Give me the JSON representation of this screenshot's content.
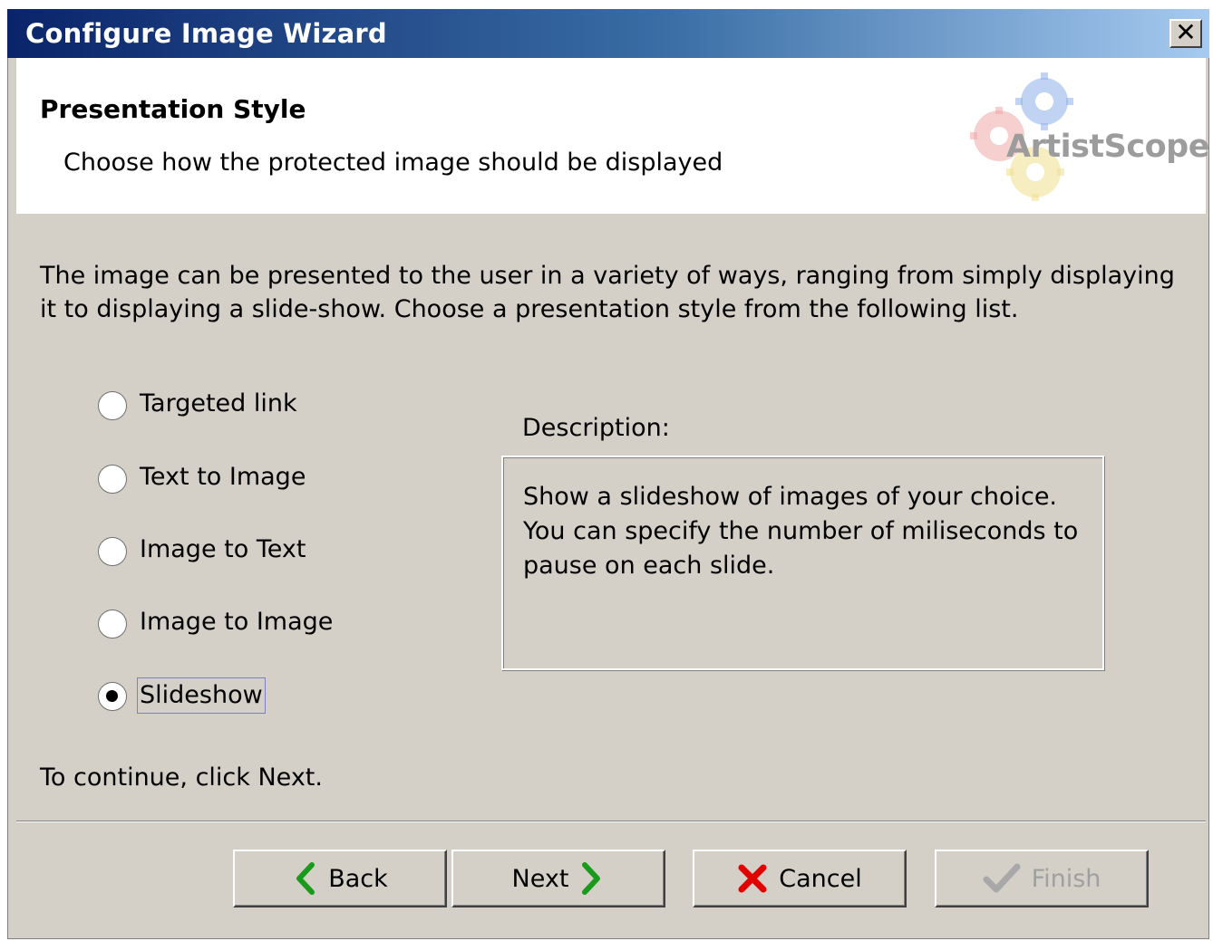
{
  "window": {
    "title": "Configure Image Wizard",
    "close_glyph": "✕"
  },
  "header": {
    "title": "Presentation Style",
    "subtitle": "Choose how the protected image should be displayed",
    "logo_text": "ArtistScope"
  },
  "intro": "The image can be presented to the user in a variety of ways, ranging from simply displaying it to displaying a slide-show. Choose a presentation style from the following list.",
  "options": [
    {
      "label": "Targeted link",
      "checked": false
    },
    {
      "label": "Text to Image",
      "checked": false
    },
    {
      "label": "Image to Text",
      "checked": false
    },
    {
      "label": "Image to Image",
      "checked": false
    },
    {
      "label": "Slideshow",
      "checked": true
    }
  ],
  "description": {
    "label": "Description:",
    "text": "Show a slideshow of images of your choice. You can specify the number of miliseconds to pause on each slide."
  },
  "continue_text": "To continue, click Next.",
  "buttons": {
    "back": "Back",
    "next": "Next",
    "cancel": "Cancel",
    "finish": "Finish"
  },
  "icons": {
    "back": "chevron-left-icon",
    "next": "chevron-right-icon",
    "cancel": "red-x-icon",
    "finish": "checkmark-icon",
    "logo": "gears-logo-icon"
  },
  "colors": {
    "title_gradient_start": "#0a246a",
    "title_gradient_end": "#a6caf0",
    "dialog_bg": "#d4d0c8",
    "nav_arrow": "#1a9a1a",
    "cancel_red": "#e00000",
    "disabled_text": "#a0a0a0"
  }
}
